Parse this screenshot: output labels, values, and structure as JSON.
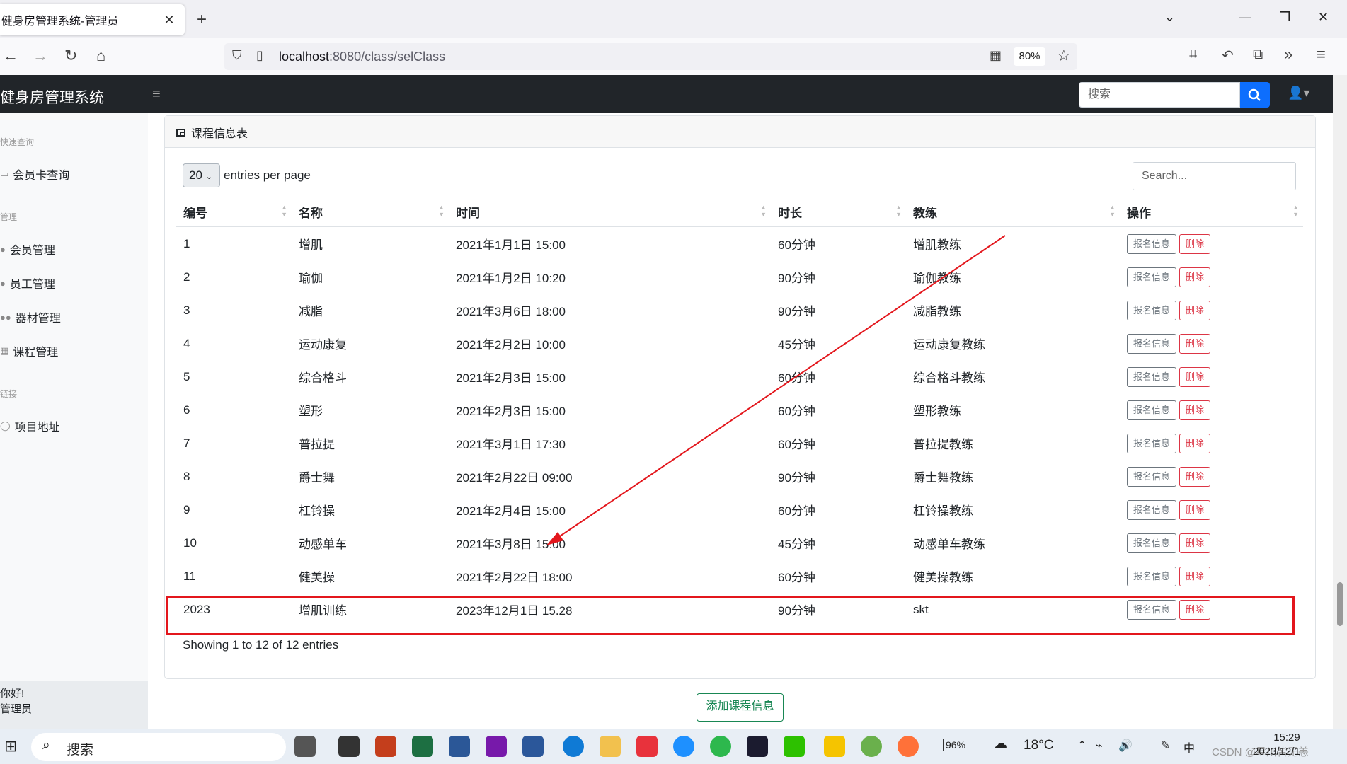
{
  "browser": {
    "tab_title": "健身房管理系统-管理员",
    "url_host": "localhost",
    "url_path": ":8080/class/selClass",
    "zoom": "80%"
  },
  "navbar": {
    "brand": "健身房管理系统",
    "search_placeholder": "搜索"
  },
  "sidebar": {
    "headings": [
      "快速查询",
      "管理",
      "链接"
    ],
    "quick_items": [
      {
        "label": "会员卡查询",
        "icon": "id-card-icon"
      }
    ],
    "manage_items": [
      {
        "label": "会员管理",
        "icon": "user-icon"
      },
      {
        "label": "员工管理",
        "icon": "user-icon"
      },
      {
        "label": "器材管理",
        "icon": "users-icon"
      },
      {
        "label": "课程管理",
        "icon": "table-icon"
      }
    ],
    "link_items": [
      {
        "label": "项目地址",
        "icon": "github-icon"
      }
    ],
    "footer_line1": "你好!",
    "footer_line2": "管理员"
  },
  "card": {
    "title": "课程信息表",
    "per_page_value": "20",
    "per_page_label": "entries per page",
    "search_placeholder": "Search...",
    "showing": "Showing 1 to 12 of 12 entries",
    "columns": [
      "编号",
      "名称",
      "时间",
      "时长",
      "教练",
      "操作"
    ],
    "rows": [
      {
        "id": "1",
        "name": "增肌",
        "time": "2021年1月1日 15:00",
        "duration": "60分钟",
        "coach": "增肌教练"
      },
      {
        "id": "2",
        "name": "瑜伽",
        "time": "2021年1月2日 10:20",
        "duration": "90分钟",
        "coach": "瑜伽教练"
      },
      {
        "id": "3",
        "name": "减脂",
        "time": "2021年3月6日 18:00",
        "duration": "90分钟",
        "coach": "减脂教练"
      },
      {
        "id": "4",
        "name": "运动康复",
        "time": "2021年2月2日 10:00",
        "duration": "45分钟",
        "coach": "运动康复教练"
      },
      {
        "id": "5",
        "name": "综合格斗",
        "time": "2021年2月3日 15:00",
        "duration": "60分钟",
        "coach": "综合格斗教练"
      },
      {
        "id": "6",
        "name": "塑形",
        "time": "2021年2月3日 15:00",
        "duration": "60分钟",
        "coach": "塑形教练"
      },
      {
        "id": "7",
        "name": "普拉提",
        "time": "2021年3月1日 17:30",
        "duration": "60分钟",
        "coach": "普拉提教练"
      },
      {
        "id": "8",
        "name": "爵士舞",
        "time": "2021年2月22日 09:00",
        "duration": "90分钟",
        "coach": "爵士舞教练"
      },
      {
        "id": "9",
        "name": "杠铃操",
        "time": "2021年2月4日 15:00",
        "duration": "60分钟",
        "coach": "杠铃操教练"
      },
      {
        "id": "10",
        "name": "动感单车",
        "time": "2021年3月8日 15:00",
        "duration": "45分钟",
        "coach": "动感单车教练"
      },
      {
        "id": "11",
        "name": "健美操",
        "time": "2021年2月22日 18:00",
        "duration": "60分钟",
        "coach": "健美操教练"
      },
      {
        "id": "2023",
        "name": "增肌训练",
        "time": "2023年12月1日 15.28",
        "duration": "90分钟",
        "coach": "skt"
      }
    ],
    "btn_info": "报名信息",
    "btn_delete": "删除",
    "add_button": "添加课程信息"
  },
  "taskbar": {
    "search_label": "搜索",
    "battery": "96%",
    "weather": "18°C",
    "time": "15:29",
    "date": "2023/12/1",
    "watermark": "CSDN @星川皆无恙"
  },
  "colors": {
    "navbar_bg": "#212529",
    "primary": "#0d6efd",
    "danger": "#dc3545",
    "success": "#198754",
    "annotation_red": "#e3161c"
  }
}
